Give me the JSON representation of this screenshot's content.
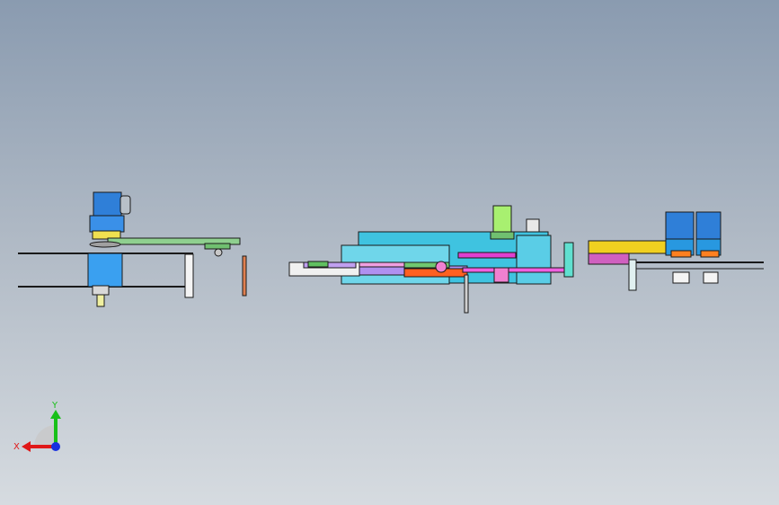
{
  "viewport": {
    "background_top": "#8a9bb0",
    "background_bottom": "#d6dbe0"
  },
  "model": {
    "assemblies": [
      "left-motor-conveyor",
      "center-feeder-module",
      "right-dual-motor-unit"
    ]
  },
  "triad": {
    "x_label": "X",
    "y_label": "Y",
    "x_color": "#e01818",
    "y_color": "#18c018",
    "z_color": "#1830e0"
  },
  "colors": {
    "motor_blue": "#2f7fd8",
    "plate_cyan": "#3fc3e0",
    "rail_green": "#5fb060",
    "accent_magenta": "#e040d0",
    "accent_orange": "#ff6020",
    "accent_yellow": "#f0d020",
    "outline": "#1a1a1a"
  }
}
